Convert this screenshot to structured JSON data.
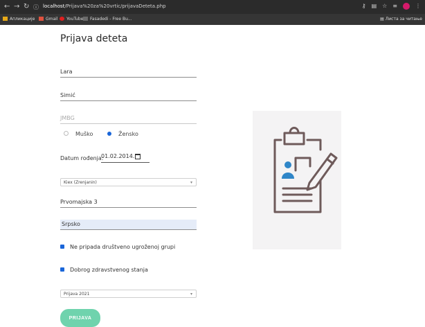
{
  "browser": {
    "url_host": "localhost",
    "url_path": "/Prijava%20za%20vrtic/prijavaDeteta.php",
    "bookmarks": [
      "Апликације",
      "Gmail",
      "YouTube",
      "Fasadedi - Free Bu...",
      "Листа за читање"
    ]
  },
  "page": {
    "title": "Prijava deteta"
  },
  "form": {
    "first_name": "Lara",
    "last_name": "Simić",
    "jmbg_placeholder": "JMBG",
    "gender_male": "Muško",
    "gender_female": "Žensko",
    "dob_label": "Datum rođenja:",
    "dob_value": "01.02.2014.",
    "kindergarten": "Kiex (Zrenjanin)",
    "address": "Prvomajska 3",
    "nationality": "Srpsko",
    "check_1": "Ne pripada društveno ugroženoj grupi",
    "check_2": "Dobrog zdravstvenog stanja",
    "period": "Prijava 2021",
    "submit": "PRIJAVA"
  },
  "colors": {
    "accent": "#6fd3ad",
    "checkbox": "#1a66d9",
    "illustration_line": "#6e5a5a",
    "illustration_fill": "#2f86c8"
  }
}
